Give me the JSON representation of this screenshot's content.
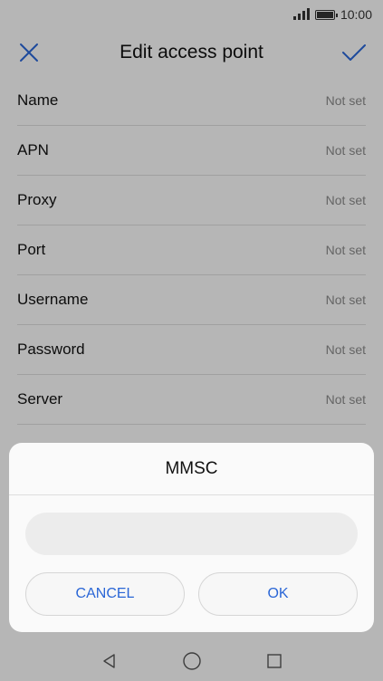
{
  "status_bar": {
    "time": "10:00",
    "icons": [
      "signal-icon",
      "battery-icon"
    ]
  },
  "app_bar": {
    "title": "Edit access point",
    "close_icon": "close-icon",
    "confirm_icon": "checkmark-icon"
  },
  "fields": [
    {
      "label": "Name",
      "value": "Not set"
    },
    {
      "label": "APN",
      "value": "Not set"
    },
    {
      "label": "Proxy",
      "value": "Not set"
    },
    {
      "label": "Port",
      "value": "Not set"
    },
    {
      "label": "Username",
      "value": "Not set"
    },
    {
      "label": "Password",
      "value": "Not set"
    },
    {
      "label": "Server",
      "value": "Not set"
    }
  ],
  "dialog": {
    "title": "MMSC",
    "input_value": "",
    "cancel_label": "CANCEL",
    "ok_label": "OK"
  },
  "nav_bar": {
    "icons": [
      "back-icon",
      "home-icon",
      "recents-icon"
    ]
  },
  "colors": {
    "accent": "#2a66d6",
    "value_text": "#8a8a8a"
  }
}
